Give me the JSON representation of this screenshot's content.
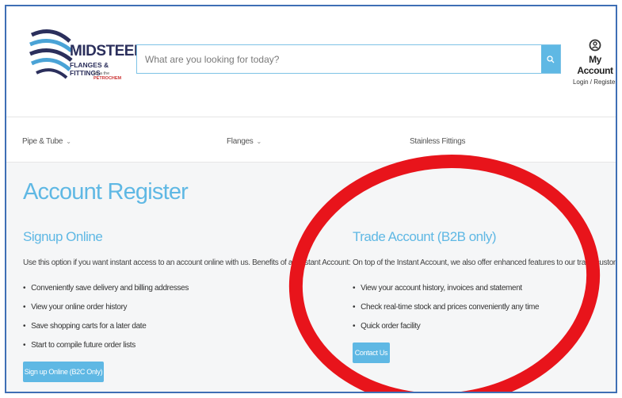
{
  "header": {
    "logo": {
      "brand": "MIDSTEEL",
      "subtitle": "FLANGES & FITTINGS",
      "tag_prefix": "for a the",
      "tag_brand": "PETROCHEM"
    },
    "search": {
      "placeholder": "What are you looking for today?"
    },
    "account": {
      "title": "My Account",
      "subtitle": "Login / Register"
    }
  },
  "nav": {
    "items": [
      {
        "label": "Pipe & Tube"
      },
      {
        "label": "Flanges"
      },
      {
        "label": "Stainless Fittings"
      }
    ]
  },
  "main": {
    "title": "Account Register",
    "signup": {
      "title": "Signup Online",
      "description": "Use this option if you want instant access to an account online with us. Benefits of an Instant Account:",
      "bullets": [
        "Conveniently save delivery and billing addresses",
        "View your online order history",
        "Save shopping carts for a later date",
        "Start to compile future order lists"
      ],
      "button": "Sign up Online (B2C Only)"
    },
    "trade": {
      "title": "Trade Account (B2B only)",
      "description": "On top of the Instant Account, we also offer enhanced features to our trade customers, including:",
      "bullets": [
        "View your account history, invoices and statement",
        "Check real-time stock and prices conveniently any time",
        "Quick order facility"
      ],
      "button": "Contact Us"
    }
  },
  "colors": {
    "accent": "#5fb8e4",
    "frame_border": "#3f6fb5",
    "annotation": "#e8141b",
    "logo_navy": "#2b2f5c"
  }
}
